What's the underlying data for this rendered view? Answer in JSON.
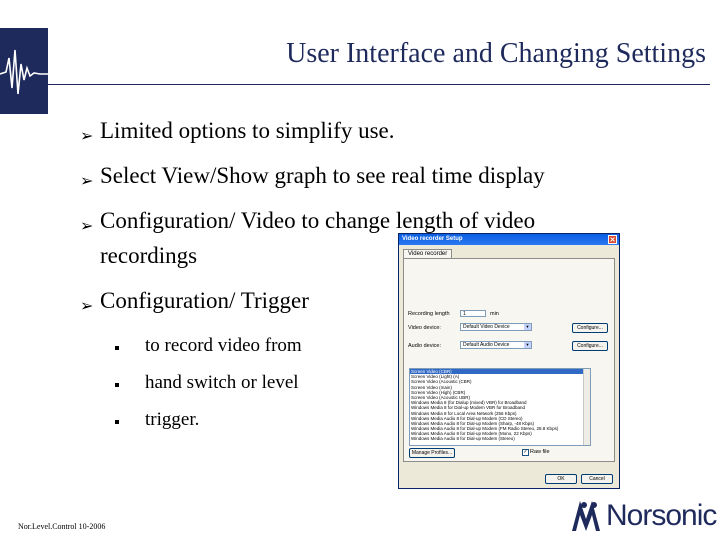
{
  "slide": {
    "title": "User Interface and Changing Settings",
    "bullets": [
      {
        "text": "Limited options to simplify use."
      },
      {
        "text": "Select View/Show graph to see real time display"
      },
      {
        "text_line1": "Configuration/ Video to change length of video",
        "text_line2": "recordings"
      },
      {
        "text": "Configuration/ Trigger"
      }
    ],
    "sub_bullets": [
      "to record video from",
      "hand switch or level",
      "trigger."
    ],
    "footer": "Nor.Level.Control  10-2006",
    "brand": "Norsonic"
  },
  "dialog": {
    "title": "Video recorder Setup",
    "tab": "Video recorder",
    "recording_length_label": "Recording length",
    "recording_length_value": "1",
    "recording_length_unit": "min",
    "video_device_label": "Video device:",
    "video_device_value": "Default Video Device",
    "audio_device_label": "Audio device:",
    "audio_device_value": "Default Audio Device",
    "configure_label": "Configure...",
    "codecs": [
      "Screen Video (CBR)",
      "Screen Video (Light) (A)",
      "Screen Video (Acoustic (CBR)",
      "Screen Video (main)",
      "Screen Video (High) (CBR)",
      "Screen Video (Acoustic UBR)",
      "Windows Media 8 (for Dialup (mixed) VBR) for Broadband",
      "Windows Media 8 for Dial-up Modem VBR for Broadband",
      "Windows Media 8 for Local Area Network (256 Kbps)",
      "Windows Media Audio 8 for Dial-up Modem (CD Stereo)",
      "Windows Media Audio 8 for Dial-up Modem (Sharp, -48 Kbps)",
      "Windows Media Audio 8 for Dial-up Modem (FM Radio Stereo, 28.8 Kbps)",
      "Windows Media Audio 8 for Dial-up Modem (Mono, 22 Kbps)",
      "Windows Media Audio 8 for Dial-up Modem (Stereo)"
    ],
    "manage_profiles_label": "Manage Profiles...",
    "raw_file_label": "Raw file",
    "ok_label": "OK",
    "cancel_label": "Cancel"
  }
}
